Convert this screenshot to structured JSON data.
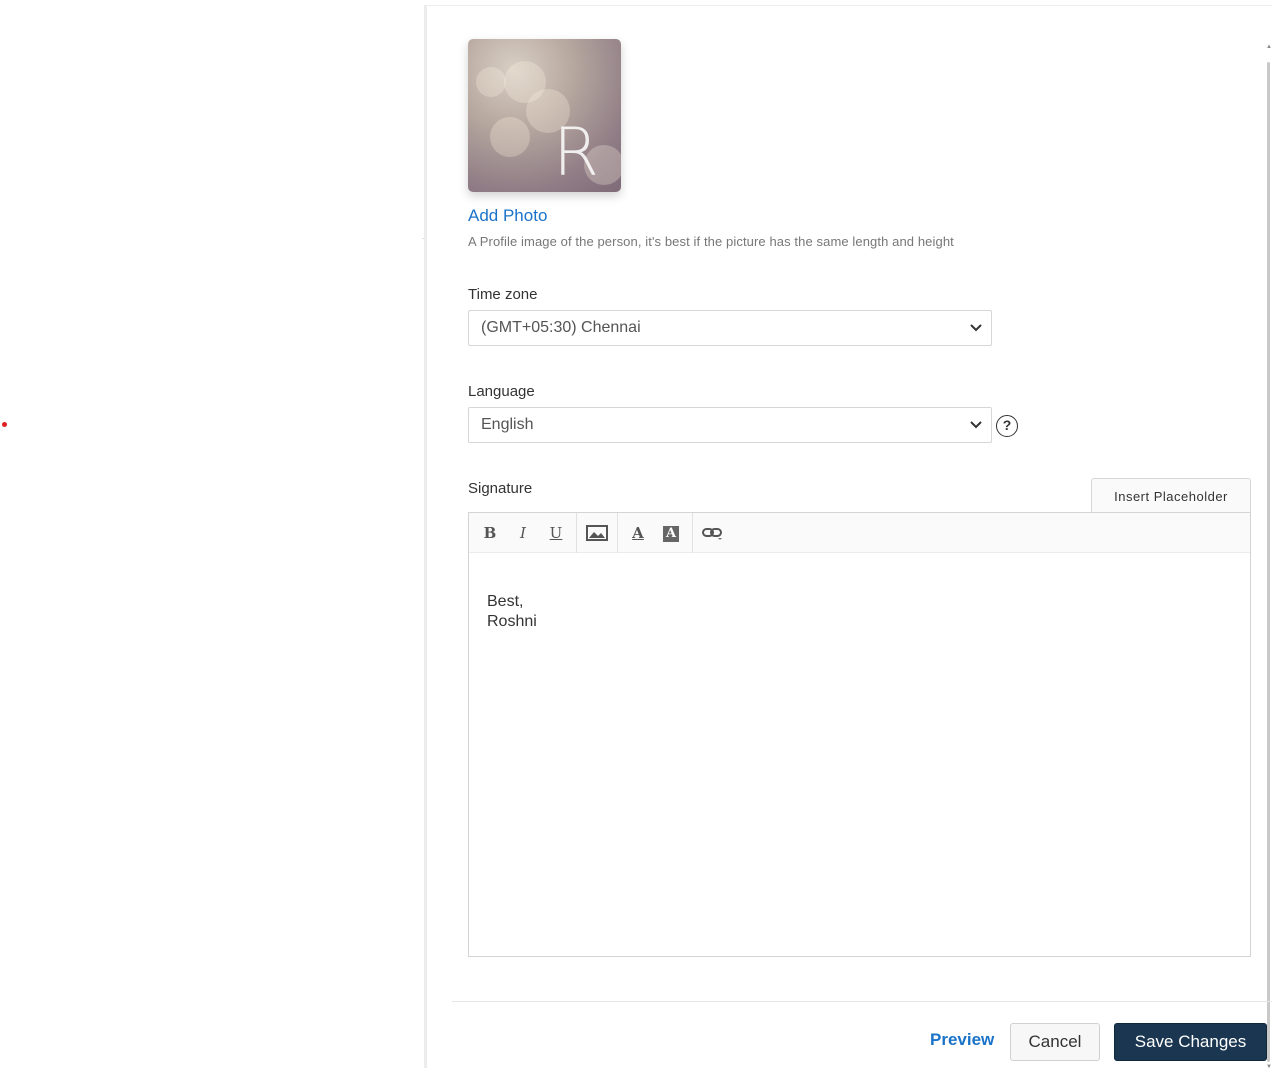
{
  "profile": {
    "avatar_letter": "R",
    "add_photo_label": "Add Photo",
    "hint": "A Profile image of the person, it's best if the picture has the same length and height"
  },
  "timezone": {
    "label": "Time zone",
    "value": "(GMT+05:30) Chennai"
  },
  "language": {
    "label": "Language",
    "value": "English",
    "help_glyph": "?"
  },
  "signature": {
    "label": "Signature",
    "insert_placeholder_label": "Insert Placeholder",
    "toolbar": {
      "bold": "B",
      "italic": "I",
      "underline": "U",
      "font_color": "A",
      "highlight": "A"
    },
    "lines": [
      "Best,",
      "Roshni"
    ]
  },
  "footer": {
    "preview_label": "Preview",
    "cancel_label": "Cancel",
    "save_label": "Save Changes"
  },
  "colors": {
    "link": "#1a73c8",
    "primary_button": "#1a3650",
    "accent_dot": "#e02020"
  }
}
